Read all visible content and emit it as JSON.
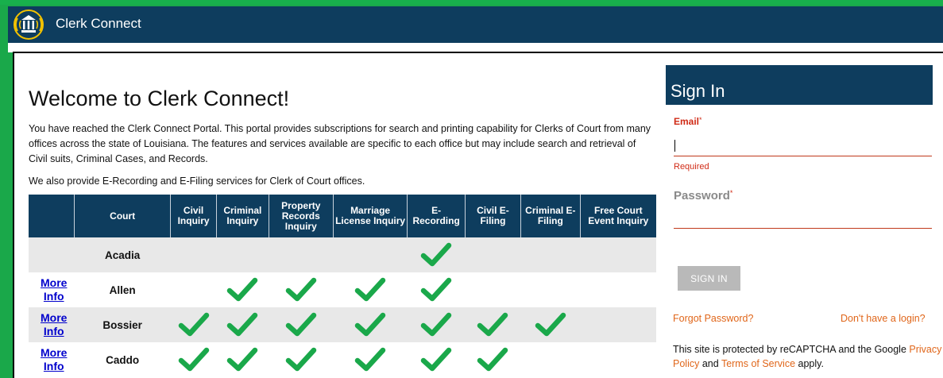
{
  "app": {
    "title": "Clerk Connect"
  },
  "main": {
    "heading": "Welcome to Clerk Connect!",
    "intro": "You have reached the Clerk Connect Portal. This portal provides subscriptions for search and printing capability for Clerks of Court from many offices across the state of Louisiana. The features and services available are specific to each office but may include search and retrieval of Civil suits, Criminal Cases, and Records.",
    "intro2": "We also provide E-Recording and E-Filing services for Clerk of Court offices.",
    "table": {
      "headers": [
        "",
        "Court",
        "Civil Inquiry",
        "Criminal Inquiry",
        "Property Records Inquiry",
        "Marriage License Inquiry",
        "E-Recording",
        "Civil E-Filing",
        "Criminal E-Filing",
        "Free Court Event Inquiry"
      ],
      "rows": [
        {
          "more": "",
          "court": "Acadia",
          "services": [
            false,
            false,
            false,
            false,
            true,
            false,
            false,
            false
          ]
        },
        {
          "more": "More Info",
          "court": "Allen",
          "services": [
            false,
            true,
            true,
            true,
            true,
            false,
            false,
            false
          ]
        },
        {
          "more": "More Info",
          "court": "Bossier",
          "services": [
            true,
            true,
            true,
            true,
            true,
            true,
            true,
            false
          ]
        },
        {
          "more": "More Info",
          "court": "Caddo",
          "services": [
            true,
            true,
            true,
            true,
            true,
            true,
            false,
            false
          ]
        }
      ]
    }
  },
  "signin": {
    "title": "Sign In",
    "email_label": "Email",
    "required_star": "*",
    "email_value": "",
    "required_text": "Required",
    "password_label": "Password",
    "button": "SIGN IN",
    "forgot": "Forgot Password?",
    "no_login": "Don't have a login?",
    "recaptcha_pre": "This site is protected by reCAPTCHA and the Google",
    "privacy": "Privacy Policy",
    "and": "and",
    "terms": "Terms of Service",
    "apply": "apply."
  },
  "colors": {
    "brand_navy": "#0e3d5e",
    "check_green": "#1aa84a",
    "error_red": "#d02b16",
    "link_orange": "#e0661a",
    "frame_green": "#1aa84a"
  },
  "icons": {
    "logo": "courthouse-logo-icon",
    "check": "check-icon"
  }
}
